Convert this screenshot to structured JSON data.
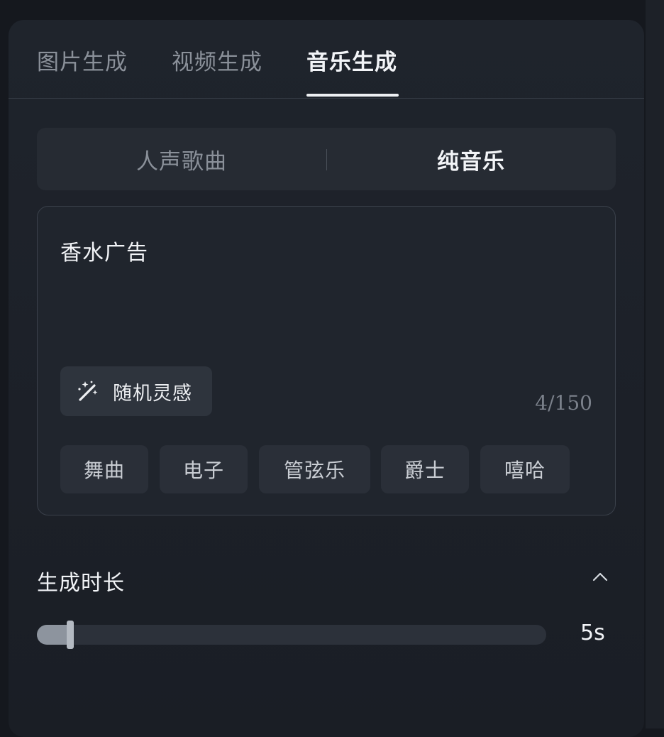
{
  "tabs": [
    {
      "label": "图片生成",
      "active": false
    },
    {
      "label": "视频生成",
      "active": false
    },
    {
      "label": "音乐生成",
      "active": true
    }
  ],
  "mode_switch": {
    "options": [
      {
        "label": "人声歌曲",
        "active": false
      },
      {
        "label": "纯音乐",
        "active": true
      }
    ]
  },
  "prompt": {
    "value": "香水广告",
    "char_count": "4/150"
  },
  "inspire_button": {
    "label": "随机灵感",
    "icon": "magic-wand-icon"
  },
  "style_tags": [
    "舞曲",
    "电子",
    "管弦乐",
    "爵士",
    "嘻哈"
  ],
  "duration": {
    "title": "生成时长",
    "value_label": "5s",
    "collapse_icon": "chevron-up-icon",
    "slider_fraction": 0.06
  },
  "colors": {
    "background": "#15181e",
    "panel": "#1f242c",
    "active_text": "#f2f4f7",
    "inactive_text": "#8a9099",
    "tag_bg": "#2a2f38"
  }
}
